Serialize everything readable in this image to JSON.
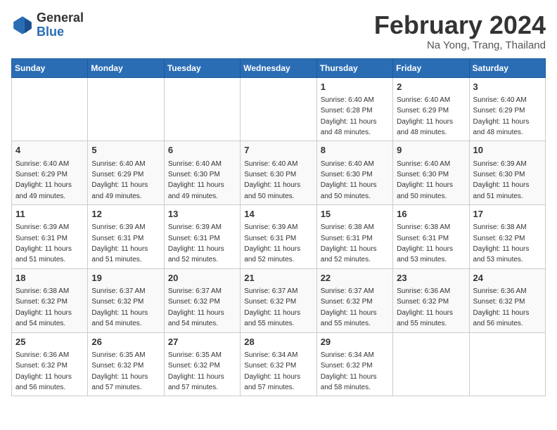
{
  "header": {
    "logo_line1": "General",
    "logo_line2": "Blue",
    "month_title": "February 2024",
    "subtitle": "Na Yong, Trang, Thailand"
  },
  "weekdays": [
    "Sunday",
    "Monday",
    "Tuesday",
    "Wednesday",
    "Thursday",
    "Friday",
    "Saturday"
  ],
  "weeks": [
    [
      {
        "day": "",
        "info": ""
      },
      {
        "day": "",
        "info": ""
      },
      {
        "day": "",
        "info": ""
      },
      {
        "day": "",
        "info": ""
      },
      {
        "day": "1",
        "info": "Sunrise: 6:40 AM\nSunset: 6:28 PM\nDaylight: 11 hours\nand 48 minutes."
      },
      {
        "day": "2",
        "info": "Sunrise: 6:40 AM\nSunset: 6:29 PM\nDaylight: 11 hours\nand 48 minutes."
      },
      {
        "day": "3",
        "info": "Sunrise: 6:40 AM\nSunset: 6:29 PM\nDaylight: 11 hours\nand 48 minutes."
      }
    ],
    [
      {
        "day": "4",
        "info": "Sunrise: 6:40 AM\nSunset: 6:29 PM\nDaylight: 11 hours\nand 49 minutes."
      },
      {
        "day": "5",
        "info": "Sunrise: 6:40 AM\nSunset: 6:29 PM\nDaylight: 11 hours\nand 49 minutes."
      },
      {
        "day": "6",
        "info": "Sunrise: 6:40 AM\nSunset: 6:30 PM\nDaylight: 11 hours\nand 49 minutes."
      },
      {
        "day": "7",
        "info": "Sunrise: 6:40 AM\nSunset: 6:30 PM\nDaylight: 11 hours\nand 50 minutes."
      },
      {
        "day": "8",
        "info": "Sunrise: 6:40 AM\nSunset: 6:30 PM\nDaylight: 11 hours\nand 50 minutes."
      },
      {
        "day": "9",
        "info": "Sunrise: 6:40 AM\nSunset: 6:30 PM\nDaylight: 11 hours\nand 50 minutes."
      },
      {
        "day": "10",
        "info": "Sunrise: 6:39 AM\nSunset: 6:30 PM\nDaylight: 11 hours\nand 51 minutes."
      }
    ],
    [
      {
        "day": "11",
        "info": "Sunrise: 6:39 AM\nSunset: 6:31 PM\nDaylight: 11 hours\nand 51 minutes."
      },
      {
        "day": "12",
        "info": "Sunrise: 6:39 AM\nSunset: 6:31 PM\nDaylight: 11 hours\nand 51 minutes."
      },
      {
        "day": "13",
        "info": "Sunrise: 6:39 AM\nSunset: 6:31 PM\nDaylight: 11 hours\nand 52 minutes."
      },
      {
        "day": "14",
        "info": "Sunrise: 6:39 AM\nSunset: 6:31 PM\nDaylight: 11 hours\nand 52 minutes."
      },
      {
        "day": "15",
        "info": "Sunrise: 6:38 AM\nSunset: 6:31 PM\nDaylight: 11 hours\nand 52 minutes."
      },
      {
        "day": "16",
        "info": "Sunrise: 6:38 AM\nSunset: 6:31 PM\nDaylight: 11 hours\nand 53 minutes."
      },
      {
        "day": "17",
        "info": "Sunrise: 6:38 AM\nSunset: 6:32 PM\nDaylight: 11 hours\nand 53 minutes."
      }
    ],
    [
      {
        "day": "18",
        "info": "Sunrise: 6:38 AM\nSunset: 6:32 PM\nDaylight: 11 hours\nand 54 minutes."
      },
      {
        "day": "19",
        "info": "Sunrise: 6:37 AM\nSunset: 6:32 PM\nDaylight: 11 hours\nand 54 minutes."
      },
      {
        "day": "20",
        "info": "Sunrise: 6:37 AM\nSunset: 6:32 PM\nDaylight: 11 hours\nand 54 minutes."
      },
      {
        "day": "21",
        "info": "Sunrise: 6:37 AM\nSunset: 6:32 PM\nDaylight: 11 hours\nand 55 minutes."
      },
      {
        "day": "22",
        "info": "Sunrise: 6:37 AM\nSunset: 6:32 PM\nDaylight: 11 hours\nand 55 minutes."
      },
      {
        "day": "23",
        "info": "Sunrise: 6:36 AM\nSunset: 6:32 PM\nDaylight: 11 hours\nand 55 minutes."
      },
      {
        "day": "24",
        "info": "Sunrise: 6:36 AM\nSunset: 6:32 PM\nDaylight: 11 hours\nand 56 minutes."
      }
    ],
    [
      {
        "day": "25",
        "info": "Sunrise: 6:36 AM\nSunset: 6:32 PM\nDaylight: 11 hours\nand 56 minutes."
      },
      {
        "day": "26",
        "info": "Sunrise: 6:35 AM\nSunset: 6:32 PM\nDaylight: 11 hours\nand 57 minutes."
      },
      {
        "day": "27",
        "info": "Sunrise: 6:35 AM\nSunset: 6:32 PM\nDaylight: 11 hours\nand 57 minutes."
      },
      {
        "day": "28",
        "info": "Sunrise: 6:34 AM\nSunset: 6:32 PM\nDaylight: 11 hours\nand 57 minutes."
      },
      {
        "day": "29",
        "info": "Sunrise: 6:34 AM\nSunset: 6:32 PM\nDaylight: 11 hours\nand 58 minutes."
      },
      {
        "day": "",
        "info": ""
      },
      {
        "day": "",
        "info": ""
      }
    ]
  ]
}
